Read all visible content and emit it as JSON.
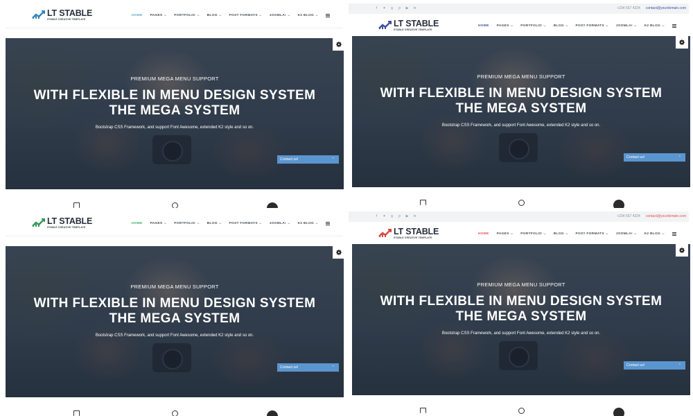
{
  "variants": [
    {
      "id": "p1",
      "accent": "#5aa9c4",
      "logo_accent": "#2f86b8",
      "has_topbar": false
    },
    {
      "id": "p2",
      "accent": "#3f4e9f",
      "logo_accent": "#3f4e9f",
      "has_topbar": true
    },
    {
      "id": "p3",
      "accent": "#3cae62",
      "logo_accent": "#2e9a55",
      "has_topbar": false
    },
    {
      "id": "p4",
      "accent": "#e14e4e",
      "logo_accent": "#d9463f",
      "has_topbar": true
    }
  ],
  "logo": {
    "wordmark": "LT STABLE",
    "tagline": "STABLE CREATIVE TEMPLATE"
  },
  "topbar": {
    "social_icons": [
      "facebook-icon",
      "twitter-icon",
      "google-plus-icon",
      "pinterest-icon",
      "youtube-icon",
      "linkedin-icon"
    ],
    "phone": "+234 567 4224",
    "email": "contact@yourdomain.com"
  },
  "nav": {
    "items": [
      {
        "label": "HOME",
        "active": true,
        "has_dropdown": false
      },
      {
        "label": "PAGES",
        "active": false,
        "has_dropdown": true
      },
      {
        "label": "PORTFOLIO",
        "active": false,
        "has_dropdown": true
      },
      {
        "label": "BLOG",
        "active": false,
        "has_dropdown": true
      },
      {
        "label": "POST FORMATS",
        "active": false,
        "has_dropdown": true
      },
      {
        "label": "JOOMLA!",
        "active": false,
        "has_dropdown": true
      },
      {
        "label": "K2 BLOG",
        "active": false,
        "has_dropdown": true
      }
    ],
    "menu_icon": "hamburger-icon"
  },
  "hero": {
    "kicker": "PREMIUM MEGA MENU SUPPORT",
    "headline_line1": "WITH FLEXIBLE IN MENU DESIGN SYSTEM",
    "headline_line2": "THE MEGA SYSTEM",
    "description": "Bootstrap CSS Framework, and support Font Awesome, extended K2 style and so on.",
    "contact_widget": "Contact us!",
    "settings_icon": "gear-icon"
  },
  "feature_icons": [
    "device-icon",
    "support-icon",
    "soccer-ball-icon"
  ]
}
